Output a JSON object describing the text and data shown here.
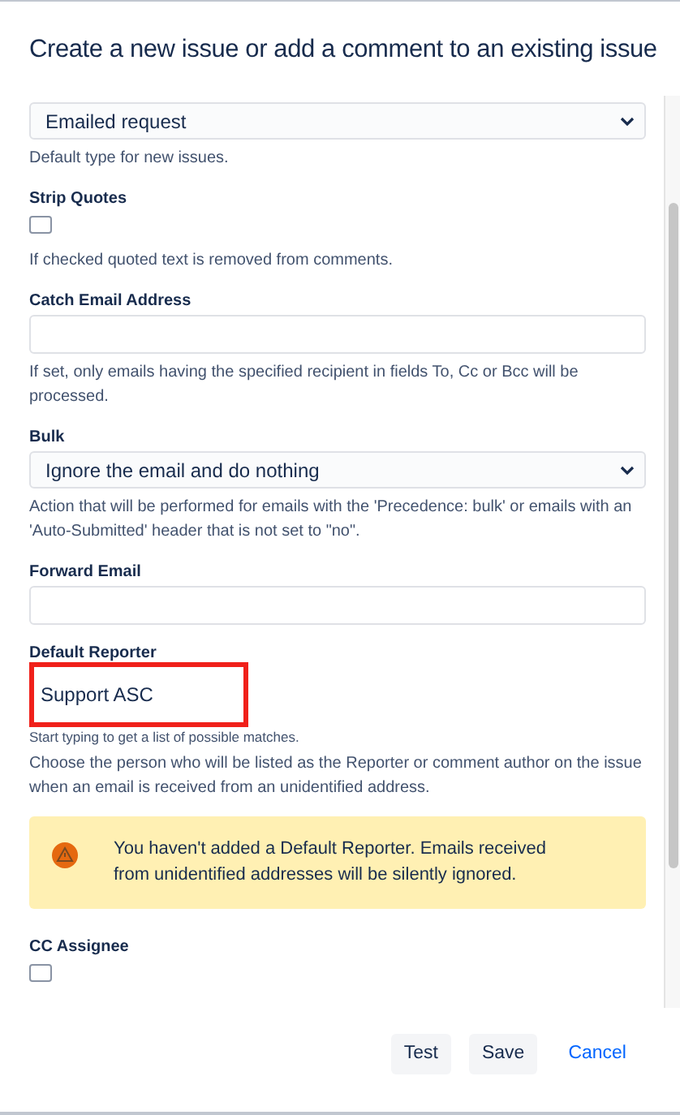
{
  "dialog": {
    "title": "Create a new issue or add a comment to an existing issue"
  },
  "fields": [
    {
      "kind": "select",
      "value": "Emailed request",
      "help": [
        "Default type for new issues."
      ]
    },
    {
      "kind": "checkbox",
      "label": "Strip Quotes",
      "checked": false,
      "help": [
        "If checked quoted text is removed from comments."
      ]
    },
    {
      "kind": "text",
      "label": "Catch Email Address",
      "help": [
        "If set, only emails having the specified recipient in fields To, Cc or Bcc will be processed."
      ]
    },
    {
      "kind": "select",
      "label": "Bulk",
      "value": "Ignore the email and do nothing",
      "help": [
        "Action that will be performed for emails with the 'Precedence: bulk' or emails with an 'Auto-Submitted' header that is not set to \"no\"."
      ]
    },
    {
      "kind": "text",
      "label": "Forward Email"
    },
    {
      "kind": "user",
      "label": "Default Reporter",
      "value": "Support ASC",
      "highlighted": true,
      "hint": "Start typing to get a list of possible matches.",
      "help": [
        "Choose the person who will be listed as the Reporter or comment author on the issue when an email is received from an unidentified address."
      ]
    },
    {
      "kind": "warning",
      "text": "You haven't added a Default Reporter. Emails received from unidentified addresses will be silently ignored."
    },
    {
      "kind": "checkbox",
      "label": "CC Assignee",
      "checked": false
    }
  ],
  "buttons": [
    {
      "label": "Test",
      "kind": "secondary"
    },
    {
      "label": "Save",
      "kind": "secondary"
    },
    {
      "label": "Cancel",
      "kind": "link"
    }
  ]
}
